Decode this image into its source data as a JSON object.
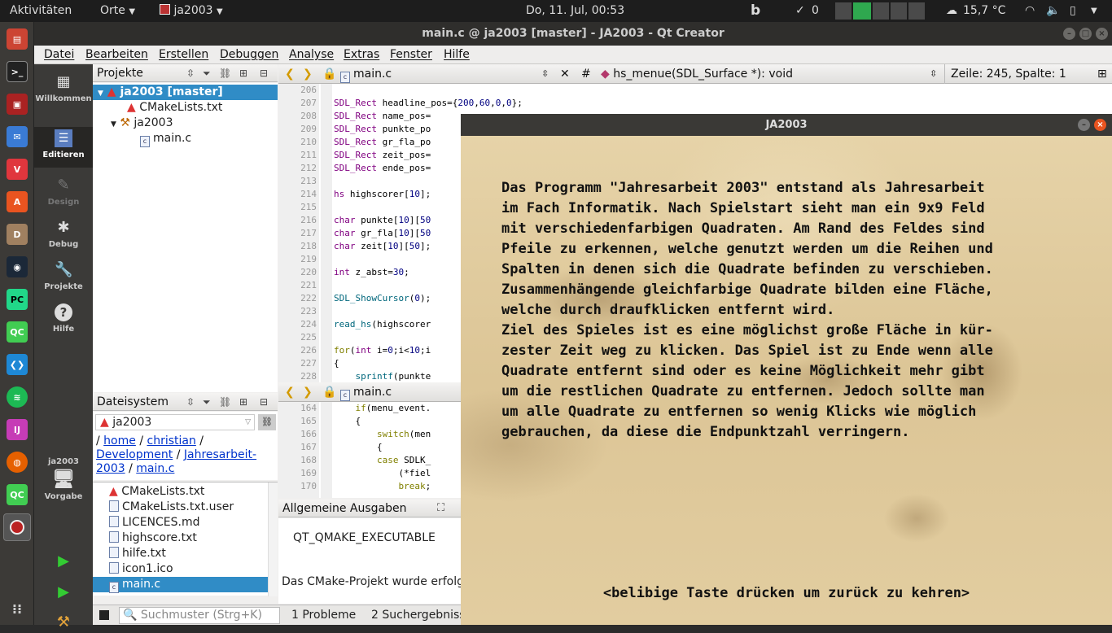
{
  "topbar": {
    "activities": "Aktivitäten",
    "places": "Orte",
    "app": "ja2003",
    "clock": "Do, 11. Jul, 00:53",
    "b_icon": "b",
    "notif_count": "0",
    "weather": "15,7 °C"
  },
  "window_title": "main.c @ ja2003 [master] - JA2003 - Qt Creator",
  "menu": [
    "Datei",
    "Bearbeiten",
    "Erstellen",
    "Debuggen",
    "Analyse",
    "Extras",
    "Fenster",
    "Hilfe"
  ],
  "modes": [
    "Willkommen",
    "Editieren",
    "Design",
    "Debug",
    "Projekte",
    "Hilfe"
  ],
  "project_kit": {
    "name": "ja2003",
    "label": "Vorgabe"
  },
  "projects": {
    "title": "Projekte",
    "root": "ja2003 [master]",
    "items": [
      "CMakeLists.txt",
      "ja2003",
      "main.c"
    ]
  },
  "filesystem": {
    "title": "Dateisystem",
    "combo": "ja2003",
    "path": [
      "/",
      "home",
      "/",
      "christian",
      "/",
      "Development",
      "/",
      "Jahresarbeit-2003",
      "/",
      "main.c"
    ],
    "files": [
      "CMakeLists.txt",
      "CMakeLists.txt.user",
      "LICENCES.md",
      "highscore.txt",
      "hilfe.txt",
      "icon1.ico",
      "main.c"
    ]
  },
  "editor": {
    "file": "main.c",
    "hash": "#",
    "symbol": "hs_menue(SDL_Surface *): void",
    "position": "Zeile: 245, Spalte: 1",
    "lines": [
      "206",
      "207",
      "208",
      "209",
      "210",
      "211",
      "212",
      "213",
      "214",
      "215",
      "216",
      "217",
      "218",
      "219",
      "220",
      "221",
      "222",
      "223",
      "224",
      "225",
      "226",
      "227",
      "228"
    ],
    "code": [
      "",
      "SDL_Rect headline_pos={200,60,0,0};",
      "SDL_Rect name_pos=",
      "SDL_Rect punkte_po",
      "SDL_Rect gr_fla_po",
      "SDL_Rect zeit_pos=",
      "SDL_Rect ende_pos=",
      "",
      "hs highscorer[10];",
      "",
      "char punkte[10][50",
      "char gr_fla[10][50",
      "char zeit[10][50];",
      "",
      "int z_abst=30;",
      "",
      "SDL_ShowCursor(0);",
      "",
      "read_hs(highscorer",
      "",
      "for(int i=0;i<10;i",
      "{",
      "    sprintf(punkte"
    ]
  },
  "editor2": {
    "file": "main.c",
    "lines": [
      "164",
      "165",
      "166",
      "167",
      "168",
      "169",
      "170"
    ],
    "code": [
      "    if(menu_event.",
      "    {",
      "        switch(men",
      "        {",
      "        case SDLK_",
      "            (*fiel",
      "            break;"
    ]
  },
  "output": {
    "title": "Allgemeine Ausgaben",
    "line1": "QT_QMAKE_EXECUTABLE",
    "line2": "Das CMake-Projekt wurde erfolg"
  },
  "statusbar": {
    "search_placeholder": "Suchmuster (Strg+K)",
    "tab1": "1  Probleme",
    "tab2": "2  Suchergebniss"
  },
  "ja2003": {
    "title": "JA2003",
    "text": "Das Programm \"Jahresarbeit 2003\" entstand als Jahresarbeit\nim Fach Informatik. Nach Spielstart sieht man ein 9x9 Feld\nmit verschiedenfarbigen Quadraten. Am Rand des Feldes sind\nPfeile zu erkennen, welche genutzt werden um die Reihen und\nSpalten in denen sich die Quadrate befinden zu verschieben.\nZusammenhängende gleichfarbige Quadrate bilden eine Fläche,\nwelche durch draufklicken entfernt wird.\nZiel des Spieles ist es eine möglichst große Fläche in kür-\nzester Zeit weg zu klicken. Das Spiel ist zu Ende wenn alle\nQuadrate entfernt sind oder es keine Möglichkeit mehr gibt\num die restlichen Quadrate zu entfernen. Jedoch sollte man\num alle Quadrate zu entfernen so wenig Klicks wie möglich\ngebrauchen, da diese die Endpunktzahl verringern.",
    "footer": "<belibige Taste drücken um zurück zu kehren>"
  }
}
